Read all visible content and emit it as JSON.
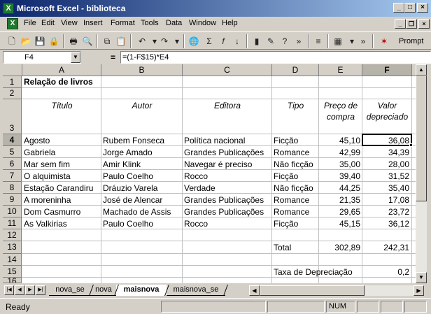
{
  "window": {
    "title": "Microsoft Excel - biblioteca"
  },
  "menu": [
    "File",
    "Edit",
    "View",
    "Insert",
    "Format",
    "Tools",
    "Data",
    "Window",
    "Help"
  ],
  "toolbar": {
    "prompt_label": "Prompt"
  },
  "formula_bar": {
    "name_box": "F4",
    "equals": "=",
    "formula": "=(1-F$15)*E4"
  },
  "grid": {
    "columns": [
      "A",
      "B",
      "C",
      "D",
      "E",
      "F"
    ],
    "rows": [
      "1",
      "2",
      "3",
      "4",
      "5",
      "6",
      "7",
      "8",
      "9",
      "10",
      "11",
      "12",
      "13",
      "14",
      "15",
      "16"
    ],
    "title": "Relação de livros",
    "headers": {
      "titulo": "Título",
      "autor": "Autor",
      "editora": "Editora",
      "tipo": "Tipo",
      "preco_line1": "Preço de",
      "preco_line2": "compra",
      "valor_line1": "Valor",
      "valor_line2": "depreciado"
    },
    "books": [
      {
        "titulo": "Agosto",
        "autor": "Rubem Fonseca",
        "editora": "Política nacional",
        "tipo": "Ficção",
        "preco": "45,10",
        "valor": "36,08"
      },
      {
        "titulo": "Gabriela",
        "autor": "Jorge Amado",
        "editora": "Grandes Publicações",
        "tipo": "Romance",
        "preco": "42,99",
        "valor": "34,39"
      },
      {
        "titulo": "Mar sem fim",
        "autor": "Amir Klink",
        "editora": "Navegar é preciso",
        "tipo": "Não ficção",
        "preco": "35,00",
        "valor": "28,00"
      },
      {
        "titulo": "O alquimista",
        "autor": "Paulo Coelho",
        "editora": "Rocco",
        "tipo": "Ficção",
        "preco": "39,40",
        "valor": "31,52"
      },
      {
        "titulo": "Estação Carandiru",
        "autor": "Dráuzio Varela",
        "editora": "Verdade",
        "tipo": "Não ficção",
        "preco": "44,25",
        "valor": "35,40"
      },
      {
        "titulo": "A moreninha",
        "autor": "José de Alencar",
        "editora": "Grandes Publicações",
        "tipo": "Romance",
        "preco": "21,35",
        "valor": "17,08"
      },
      {
        "titulo": "Dom Casmurro",
        "autor": "Machado de Assis",
        "editora": "Grandes Publicações",
        "tipo": "Romance",
        "preco": "29,65",
        "valor": "23,72"
      },
      {
        "titulo": "As Valkirias",
        "autor": "Paulo Coelho",
        "editora": "Rocco",
        "tipo": "Ficção",
        "preco": "45,15",
        "valor": "36,12"
      }
    ],
    "total": {
      "label": "Total",
      "preco": "302,89",
      "valor": "242,31"
    },
    "taxa": {
      "label": "Taxa de Depreciação",
      "value": "0,2"
    }
  },
  "sheet_tabs": [
    "nova_se",
    "nova",
    "maisnova",
    "maisnova_se"
  ],
  "active_tab": "maisnova",
  "status": {
    "ready": "Ready",
    "num": "NUM"
  }
}
